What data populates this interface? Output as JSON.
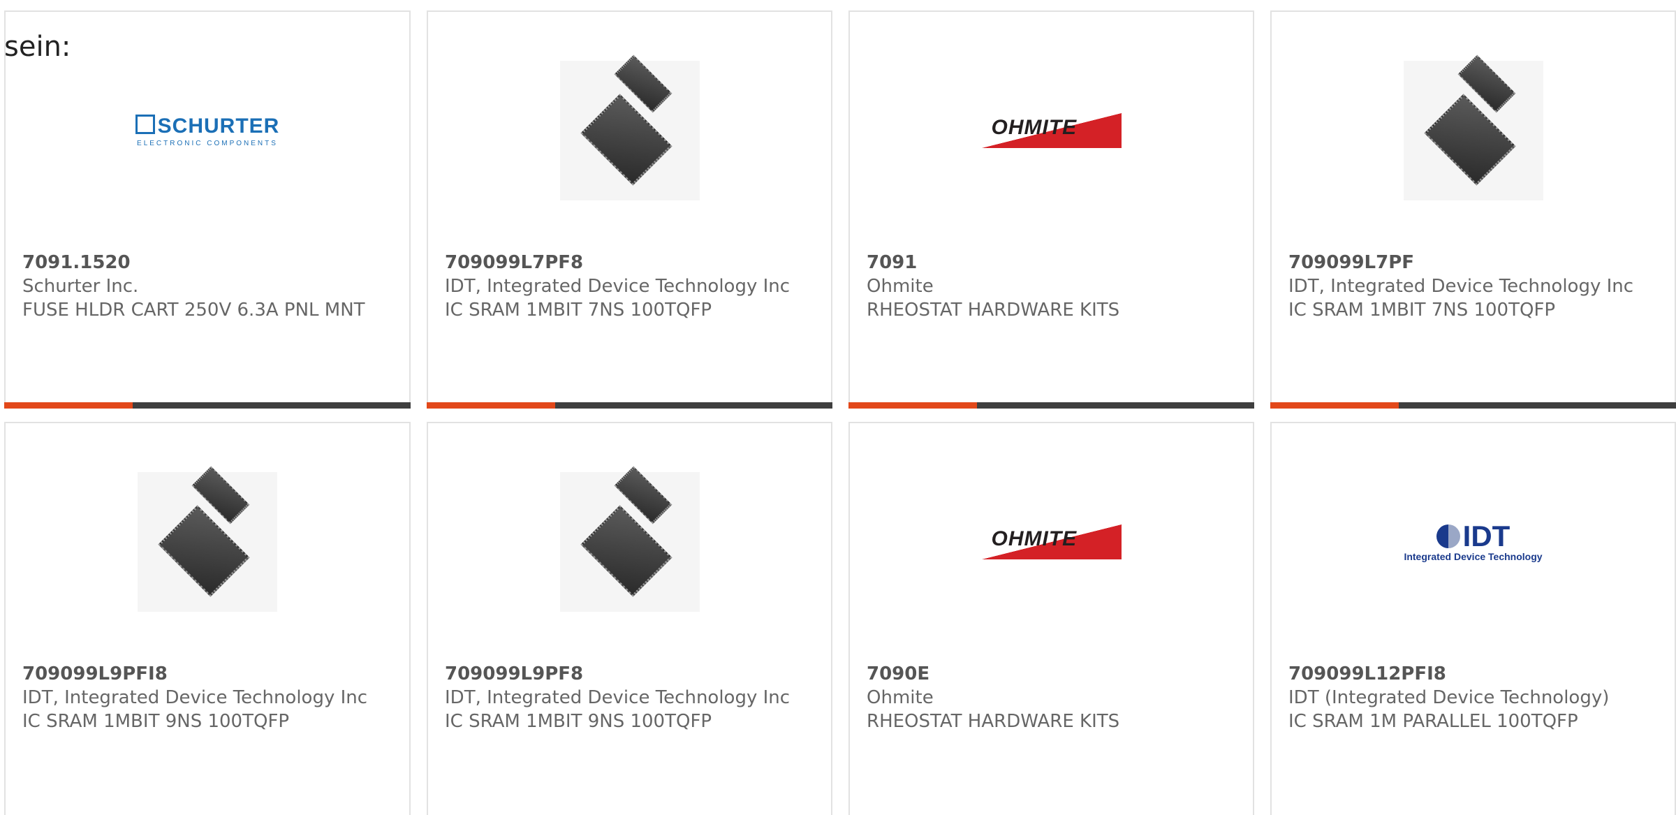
{
  "heading": "sein:",
  "colors": {
    "accent": "#e2481a",
    "bar_dark": "#3f3f3f",
    "border": "#e2e2e2"
  },
  "cards": [
    {
      "part_number": "7091.1520",
      "manufacturer": "Schurter Inc.",
      "description": "FUSE HLDR CART 250V 6.3A PNL MNT",
      "image": "schurter-logo",
      "logo_text": "SCHURTER",
      "logo_sub": "ELECTRONIC COMPONENTS"
    },
    {
      "part_number": "709099L7PF8",
      "manufacturer": "IDT, Integrated Device Technology Inc",
      "description": "IC SRAM 1MBIT 7NS 100TQFP",
      "image": "tqfp-chip-photo"
    },
    {
      "part_number": "7091",
      "manufacturer": "Ohmite",
      "description": "RHEOSTAT HARDWARE KITS",
      "image": "ohmite-logo",
      "logo_text": "OHMITE"
    },
    {
      "part_number": "709099L7PF",
      "manufacturer": "IDT, Integrated Device Technology Inc",
      "description": "IC SRAM 1MBIT 7NS 100TQFP",
      "image": "tqfp-chip-photo"
    },
    {
      "part_number": "709099L9PFI8",
      "manufacturer": "IDT, Integrated Device Technology Inc",
      "description": "IC SRAM 1MBIT 9NS 100TQFP",
      "image": "tqfp-chip-photo"
    },
    {
      "part_number": "709099L9PF8",
      "manufacturer": "IDT, Integrated Device Technology Inc",
      "description": "IC SRAM 1MBIT 9NS 100TQFP",
      "image": "tqfp-chip-photo"
    },
    {
      "part_number": "7090E",
      "manufacturer": "Ohmite",
      "description": "RHEOSTAT HARDWARE KITS",
      "image": "ohmite-logo",
      "logo_text": "OHMITE"
    },
    {
      "part_number": "709099L12PFI8",
      "manufacturer": "IDT (Integrated Device Technology)",
      "description": "IC SRAM 1M PARALLEL 100TQFP",
      "image": "idt-logo",
      "logo_text": "IDT",
      "logo_sub": "Integrated Device Technology"
    }
  ]
}
